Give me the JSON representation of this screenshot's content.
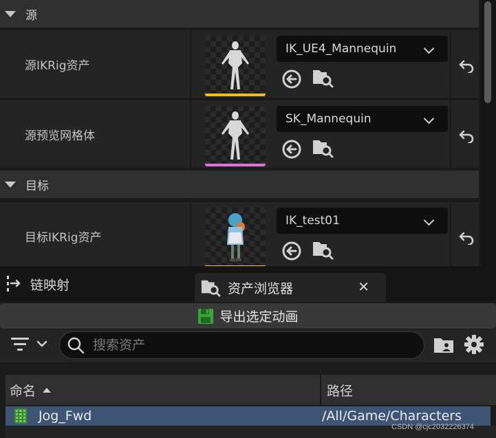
{
  "details": {
    "sections": [
      {
        "title": "源"
      },
      {
        "title": "目标"
      }
    ],
    "rows": [
      {
        "label": "源IKRig资产",
        "asset": "IK_UE4_Mannequin",
        "thumb_bar_color": "#f0c020"
      },
      {
        "label": "源预览网格体",
        "asset": "SK_Mannequin",
        "thumb_bar_color": "#e070e0"
      },
      {
        "label": "目标IKRig资产",
        "asset": "IK_test01",
        "thumb_bar_color": "#f0c020"
      }
    ]
  },
  "tabs": {
    "chain_mapping": "链映射",
    "asset_browser": "资产浏览器",
    "close": "✕"
  },
  "browser": {
    "export_label": "导出选定动画",
    "search_placeholder": "搜索资产",
    "columns": {
      "name": "命名",
      "path": "路径"
    },
    "assets": [
      {
        "name": "Jog_Fwd",
        "path": "/All/Game/Characters"
      }
    ]
  },
  "watermark": "CSDN @cjc2032226374",
  "colors": {
    "selection": "#3d5475",
    "accent_yellow": "#f0c020",
    "accent_pink": "#e070e0",
    "save_green": "#3aa53a"
  }
}
